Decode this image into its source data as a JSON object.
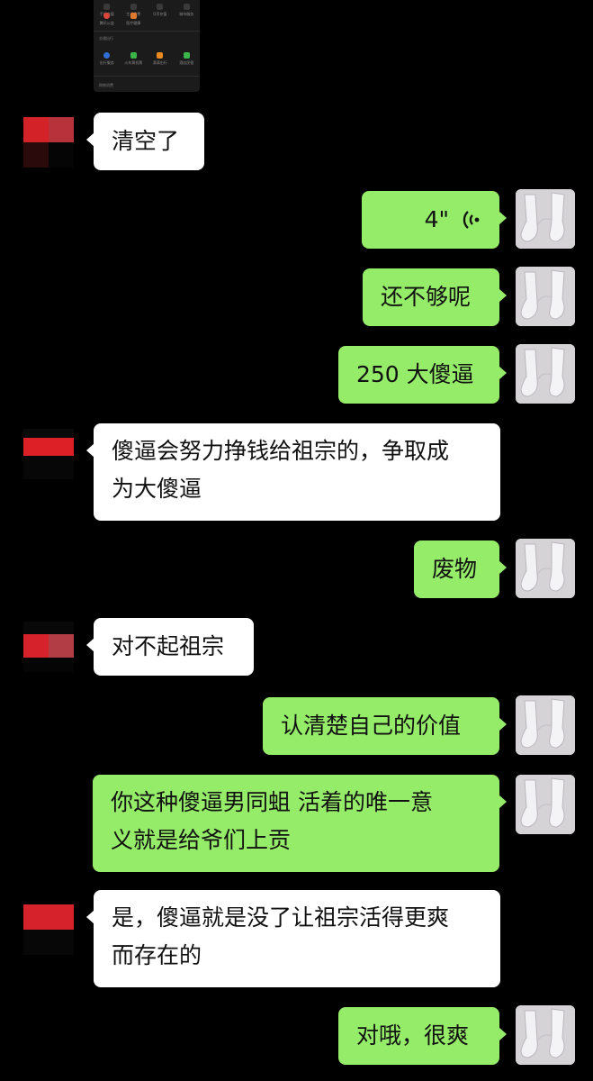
{
  "shared_card": {
    "row1": [
      "手机充值",
      "生活缴费",
      "Q币充值",
      "城市服务"
    ],
    "row2": [
      "腾讯公益",
      "医疗健康"
    ],
    "section_label": "交通出行",
    "row3": [
      "出行服务",
      "火车票机票",
      "滴滴出行",
      "酒店民宿"
    ],
    "footer_label": "购物消费"
  },
  "messages": [
    {
      "side": "in",
      "text": "清空了"
    },
    {
      "side": "out",
      "type": "voice",
      "text": "4\""
    },
    {
      "side": "out",
      "text": "还不够呢"
    },
    {
      "side": "out",
      "text": "250 大傻逼"
    },
    {
      "side": "in",
      "text": "傻逼会努力挣钱给祖宗的，争取成\n为大傻逼"
    },
    {
      "side": "out",
      "text": "废物"
    },
    {
      "side": "in",
      "text": "对不起祖宗"
    },
    {
      "side": "out",
      "text": "认清楚自己的价值"
    },
    {
      "side": "out",
      "text": "你这种傻逼男同蛆 活着的唯一意\n义就是给爷们上贡"
    },
    {
      "side": "in",
      "text": "是，傻逼就是没了让祖宗活得更爽\n而存在的"
    },
    {
      "side": "out",
      "text": "对哦，很爽"
    }
  ],
  "colors": {
    "background": "#000000",
    "incoming_bubble": "#ffffff",
    "outgoing_bubble": "#95ec69",
    "text": "#111111"
  },
  "icons": {
    "voice": "voice-wave-icon",
    "avatar_left": "pixelated-avatar",
    "avatar_right": "socks-photo-avatar"
  }
}
